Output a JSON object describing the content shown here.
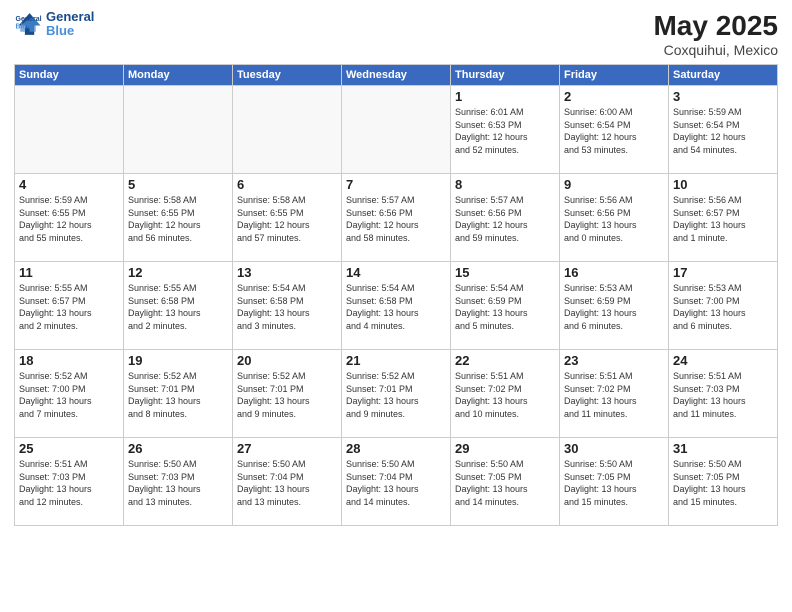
{
  "logo": {
    "line1": "General",
    "line2": "Blue"
  },
  "title": "May 2025",
  "subtitle": "Coxquihui, Mexico",
  "days_of_week": [
    "Sunday",
    "Monday",
    "Tuesday",
    "Wednesday",
    "Thursday",
    "Friday",
    "Saturday"
  ],
  "weeks": [
    [
      {
        "day": "",
        "info": ""
      },
      {
        "day": "",
        "info": ""
      },
      {
        "day": "",
        "info": ""
      },
      {
        "day": "",
        "info": ""
      },
      {
        "day": "1",
        "info": "Sunrise: 6:01 AM\nSunset: 6:53 PM\nDaylight: 12 hours\nand 52 minutes."
      },
      {
        "day": "2",
        "info": "Sunrise: 6:00 AM\nSunset: 6:54 PM\nDaylight: 12 hours\nand 53 minutes."
      },
      {
        "day": "3",
        "info": "Sunrise: 5:59 AM\nSunset: 6:54 PM\nDaylight: 12 hours\nand 54 minutes."
      }
    ],
    [
      {
        "day": "4",
        "info": "Sunrise: 5:59 AM\nSunset: 6:55 PM\nDaylight: 12 hours\nand 55 minutes."
      },
      {
        "day": "5",
        "info": "Sunrise: 5:58 AM\nSunset: 6:55 PM\nDaylight: 12 hours\nand 56 minutes."
      },
      {
        "day": "6",
        "info": "Sunrise: 5:58 AM\nSunset: 6:55 PM\nDaylight: 12 hours\nand 57 minutes."
      },
      {
        "day": "7",
        "info": "Sunrise: 5:57 AM\nSunset: 6:56 PM\nDaylight: 12 hours\nand 58 minutes."
      },
      {
        "day": "8",
        "info": "Sunrise: 5:57 AM\nSunset: 6:56 PM\nDaylight: 12 hours\nand 59 minutes."
      },
      {
        "day": "9",
        "info": "Sunrise: 5:56 AM\nSunset: 6:56 PM\nDaylight: 13 hours\nand 0 minutes."
      },
      {
        "day": "10",
        "info": "Sunrise: 5:56 AM\nSunset: 6:57 PM\nDaylight: 13 hours\nand 1 minute."
      }
    ],
    [
      {
        "day": "11",
        "info": "Sunrise: 5:55 AM\nSunset: 6:57 PM\nDaylight: 13 hours\nand 2 minutes."
      },
      {
        "day": "12",
        "info": "Sunrise: 5:55 AM\nSunset: 6:58 PM\nDaylight: 13 hours\nand 2 minutes."
      },
      {
        "day": "13",
        "info": "Sunrise: 5:54 AM\nSunset: 6:58 PM\nDaylight: 13 hours\nand 3 minutes."
      },
      {
        "day": "14",
        "info": "Sunrise: 5:54 AM\nSunset: 6:58 PM\nDaylight: 13 hours\nand 4 minutes."
      },
      {
        "day": "15",
        "info": "Sunrise: 5:54 AM\nSunset: 6:59 PM\nDaylight: 13 hours\nand 5 minutes."
      },
      {
        "day": "16",
        "info": "Sunrise: 5:53 AM\nSunset: 6:59 PM\nDaylight: 13 hours\nand 6 minutes."
      },
      {
        "day": "17",
        "info": "Sunrise: 5:53 AM\nSunset: 7:00 PM\nDaylight: 13 hours\nand 6 minutes."
      }
    ],
    [
      {
        "day": "18",
        "info": "Sunrise: 5:52 AM\nSunset: 7:00 PM\nDaylight: 13 hours\nand 7 minutes."
      },
      {
        "day": "19",
        "info": "Sunrise: 5:52 AM\nSunset: 7:01 PM\nDaylight: 13 hours\nand 8 minutes."
      },
      {
        "day": "20",
        "info": "Sunrise: 5:52 AM\nSunset: 7:01 PM\nDaylight: 13 hours\nand 9 minutes."
      },
      {
        "day": "21",
        "info": "Sunrise: 5:52 AM\nSunset: 7:01 PM\nDaylight: 13 hours\nand 9 minutes."
      },
      {
        "day": "22",
        "info": "Sunrise: 5:51 AM\nSunset: 7:02 PM\nDaylight: 13 hours\nand 10 minutes."
      },
      {
        "day": "23",
        "info": "Sunrise: 5:51 AM\nSunset: 7:02 PM\nDaylight: 13 hours\nand 11 minutes."
      },
      {
        "day": "24",
        "info": "Sunrise: 5:51 AM\nSunset: 7:03 PM\nDaylight: 13 hours\nand 11 minutes."
      }
    ],
    [
      {
        "day": "25",
        "info": "Sunrise: 5:51 AM\nSunset: 7:03 PM\nDaylight: 13 hours\nand 12 minutes."
      },
      {
        "day": "26",
        "info": "Sunrise: 5:50 AM\nSunset: 7:03 PM\nDaylight: 13 hours\nand 13 minutes."
      },
      {
        "day": "27",
        "info": "Sunrise: 5:50 AM\nSunset: 7:04 PM\nDaylight: 13 hours\nand 13 minutes."
      },
      {
        "day": "28",
        "info": "Sunrise: 5:50 AM\nSunset: 7:04 PM\nDaylight: 13 hours\nand 14 minutes."
      },
      {
        "day": "29",
        "info": "Sunrise: 5:50 AM\nSunset: 7:05 PM\nDaylight: 13 hours\nand 14 minutes."
      },
      {
        "day": "30",
        "info": "Sunrise: 5:50 AM\nSunset: 7:05 PM\nDaylight: 13 hours\nand 15 minutes."
      },
      {
        "day": "31",
        "info": "Sunrise: 5:50 AM\nSunset: 7:05 PM\nDaylight: 13 hours\nand 15 minutes."
      }
    ]
  ]
}
